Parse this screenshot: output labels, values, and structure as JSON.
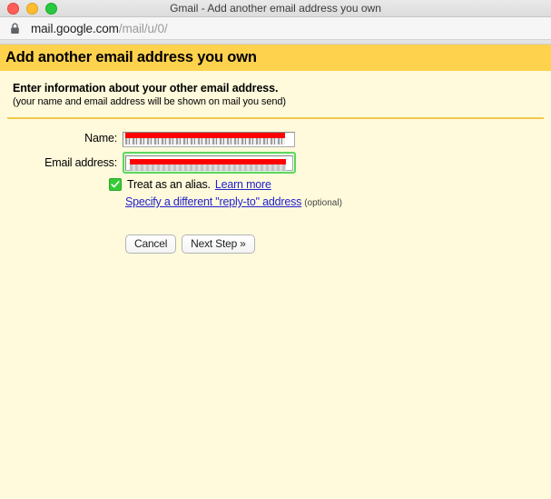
{
  "window": {
    "title": "Gmail - Add another email address you own",
    "traffic_lights": [
      "close-button",
      "minimize-button",
      "maximize-button"
    ]
  },
  "browser": {
    "lock_icon": "lock-icon",
    "url_domain": "mail.google.com",
    "url_path": "/mail/u/0/"
  },
  "page": {
    "header_title": "Add another email address you own",
    "intro_headline": "Enter information about your other email address.",
    "intro_sub": "(your name and email address will be shown on mail you send)"
  },
  "form": {
    "name_label": "Name:",
    "name_value": "",
    "email_label": "Email address:",
    "email_value": "",
    "alias_checkbox_checked": true,
    "alias_text": "Treat as an alias.",
    "learn_more_link": "Learn more",
    "reply_to_link": "Specify a different \"reply-to\" address",
    "optional_text": "(optional)"
  },
  "buttons": {
    "cancel": "Cancel",
    "next_step": "Next Step »"
  },
  "colors": {
    "header_bar": "#ffd24d",
    "page_background": "#fffadc",
    "divider": "#f2c94c",
    "link": "#2222cc",
    "checkbox_green": "#33cc33",
    "focus_green": "#5cd65c",
    "redaction_red": "#ff0000"
  }
}
